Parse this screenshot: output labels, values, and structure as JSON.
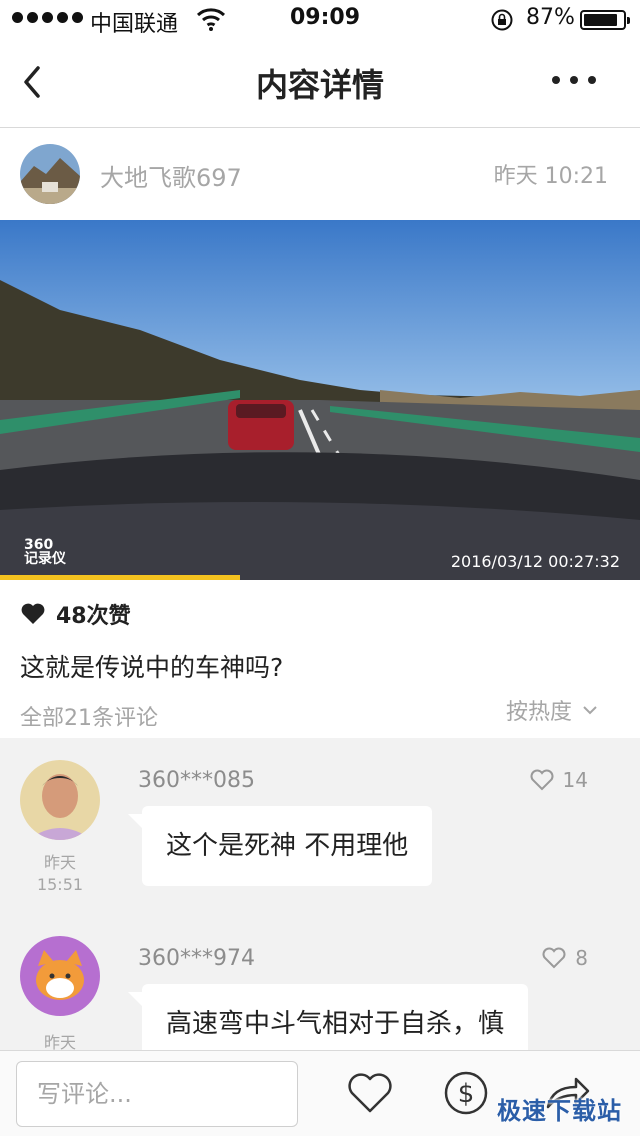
{
  "status_bar": {
    "carrier": "中国联通",
    "time": "09:09",
    "battery_percent_label": "87%",
    "battery_level": 0.87,
    "signal_dots": 5
  },
  "nav": {
    "title": "内容详情"
  },
  "author": {
    "name": "大地飞歌697",
    "time": "昨天 10:21"
  },
  "video": {
    "watermark_line1": "360",
    "watermark_line2": "记录仪",
    "timestamp": "2016/03/12   00:27:32",
    "progress": 0.375
  },
  "post": {
    "likes": "48次赞",
    "text": "这就是传说中的车神吗?",
    "comment_count": "全部21条评论",
    "sort_label": "按热度"
  },
  "comments": [
    {
      "user": "360***085",
      "likes": "14",
      "text": "这个是死神 不用理他",
      "time_day": "昨天",
      "time_clock": "15:51"
    },
    {
      "user": "360***974",
      "likes": "8",
      "text": "高速弯中斗气相对于自杀，慎",
      "time_day": "昨天"
    }
  ],
  "bottom_bar": {
    "comment_placeholder": "写评论...",
    "site_watermark": "极速下载站"
  },
  "colors": {
    "accent_progress": "#f4c21f",
    "comment_bg": "#f2f2f2",
    "muted_text": "#a6a6a6"
  },
  "icons": [
    "back-arrow-icon",
    "more-dots-icon",
    "heart-icon",
    "chevron-down-icon",
    "heart-outline-icon",
    "dollar-coin-icon",
    "share-arrow-icon",
    "wifi-icon",
    "lock-rotation-icon",
    "battery-icon"
  ]
}
